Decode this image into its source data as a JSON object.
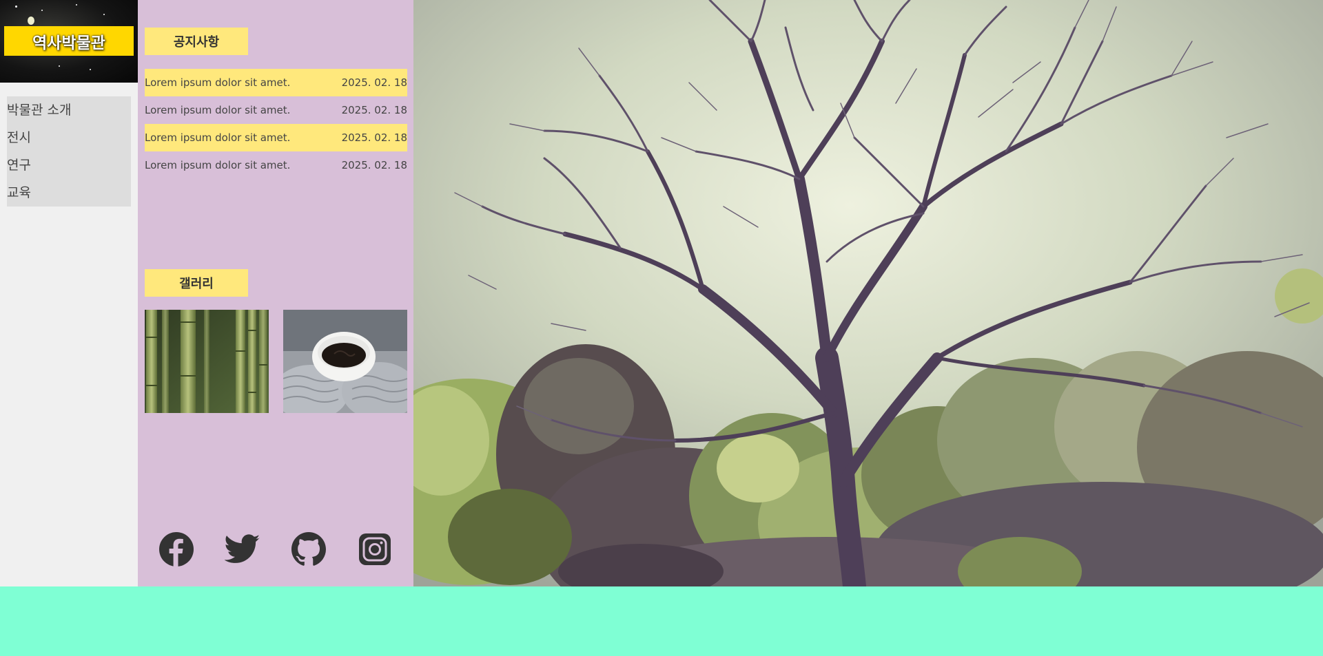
{
  "logo": {
    "text": "역사박물관"
  },
  "menu": {
    "items": [
      {
        "label": "박물관 소개"
      },
      {
        "label": "전시"
      },
      {
        "label": "연구"
      },
      {
        "label": "교육"
      }
    ]
  },
  "notice": {
    "title": "공지사항",
    "items": [
      {
        "text": "Lorem ipsum dolor sit amet.",
        "date": "2025. 02. 18",
        "highlighted": true
      },
      {
        "text": "Lorem ipsum dolor sit amet.",
        "date": "2025. 02. 18",
        "highlighted": false
      },
      {
        "text": "Lorem ipsum dolor sit amet.",
        "date": "2025. 02. 18",
        "highlighted": true
      },
      {
        "text": "Lorem ipsum dolor sit amet.",
        "date": "2025. 02. 18",
        "highlighted": false
      }
    ]
  },
  "gallery": {
    "title": "갤러리",
    "images": [
      {
        "subject": "bamboo-stalks"
      },
      {
        "subject": "coffee-cup-in-knit-gloves"
      }
    ]
  },
  "social": {
    "icons": [
      "facebook-icon",
      "twitter-icon",
      "github-icon",
      "instagram-icon"
    ]
  },
  "hero": {
    "subject": "bare-tree-against-sky"
  },
  "colors": {
    "logo_bg": "#ffd700",
    "accent": "#ffe87c",
    "mid_bg": "#d8bfd8",
    "left_bg": "#f0f0f0",
    "menu_bg": "#dddddd",
    "footer_bg": "#7fffd4",
    "icon": "#333333"
  }
}
